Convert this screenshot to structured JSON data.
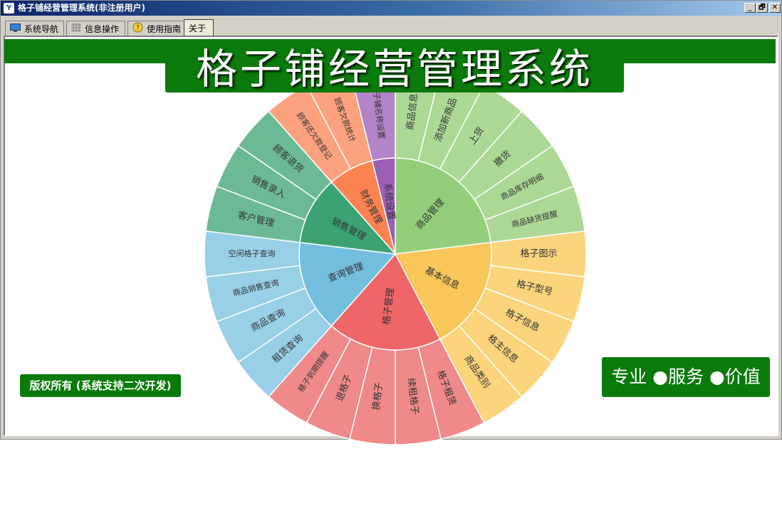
{
  "window": {
    "title": "格子铺经营管理系统(非注册用户)",
    "controls": {
      "minimize": "_",
      "restore": "🗗",
      "close": "✕"
    }
  },
  "tabs": [
    {
      "label": "系统导航",
      "icon": "monitor-icon",
      "active": false
    },
    {
      "label": "信息操作",
      "icon": "grid-icon",
      "active": false
    },
    {
      "label": "使用指南",
      "icon": "help-icon",
      "active": false
    },
    {
      "label": "关于",
      "icon": "",
      "active": true
    }
  ],
  "about": {
    "heading": "格子铺经营管理系统",
    "copyright": "版权所有 (系统支持二次开发)",
    "slogan": "专业 ●服务 ●价值"
  },
  "colors": {
    "brand_green": "#0a7a0a",
    "titlebar": "#0a246a"
  },
  "sunburst": {
    "categories": [
      {
        "name": "商品管理",
        "color": "#93cf7a",
        "leafColor": "#acd996",
        "leaves": [
          "商品信息",
          "添加新商品",
          "上货",
          "撤货",
          "商品库存明细",
          "商品缺货提醒"
        ]
      },
      {
        "name": "基本信息",
        "color": "#f9c75a",
        "leafColor": "#fbd47c",
        "leaves": [
          "格子图示",
          "格子型号",
          "格子信息",
          "格主信息",
          "商品类别"
        ]
      },
      {
        "name": "格子管理",
        "color": "#ee6666",
        "leafColor": "#f08a8a",
        "leaves": [
          "格子租赁",
          "续租格子",
          "换格子",
          "退格子",
          "格子到期提醒"
        ]
      },
      {
        "name": "查询管理",
        "color": "#73c0de",
        "leafColor": "#98d0e8",
        "leaves": [
          "租赁查询",
          "商品查询",
          "商品销售查询",
          "空闲格子查询"
        ]
      },
      {
        "name": "销售管理",
        "color": "#3ba272",
        "leafColor": "#6cba95",
        "leaves": [
          "客户管理",
          "销售录入",
          "顾客退货"
        ]
      },
      {
        "name": "财务管理",
        "color": "#fc8452",
        "leafColor": "#fda27e",
        "leaves": [
          "顾客还欠款登记",
          "顾客欠款统计"
        ]
      },
      {
        "name": "系统设置",
        "color": "#9a60b4",
        "leafColor": "#b384c8",
        "leaves": [
          "格子铺名称设置"
        ]
      }
    ]
  }
}
